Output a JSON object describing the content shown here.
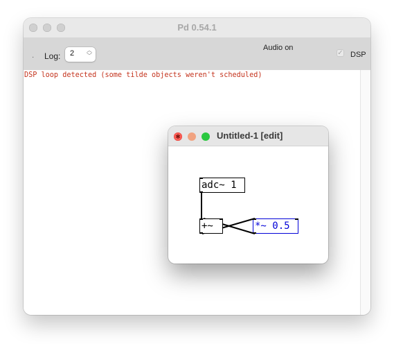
{
  "main_window": {
    "title": "Pd 0.54.1",
    "toolbar": {
      "log_label": "Log:",
      "log_value": "2",
      "audio_status": "Audio on",
      "dsp_label": "DSP",
      "dsp_checked": true
    },
    "console": {
      "lines": [
        "DSP loop detected (some tilde objects weren't scheduled)"
      ],
      "error_color": "#c4341e"
    }
  },
  "patch_window": {
    "title": "Untitled-1 [edit]",
    "objects": [
      {
        "id": "adc",
        "text": "adc~ 1",
        "selected": false
      },
      {
        "id": "plus",
        "text": "+~",
        "selected": false
      },
      {
        "id": "mul",
        "text": "*~ 0.5",
        "selected": true
      }
    ],
    "selection_color": "#0000d8"
  }
}
